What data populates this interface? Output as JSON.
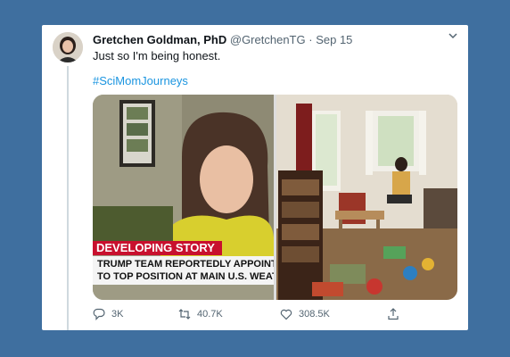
{
  "tweet": {
    "author_name": "Gretchen Goldman, PhD",
    "handle": "@GretchenTG",
    "separator": "·",
    "date": "Sep 15",
    "text": "Just so I'm being honest.",
    "hashtag": "#SciMomJourneys"
  },
  "media": {
    "left_photo": {
      "chyron_label": "DEVELOPING STORY",
      "chyron_line1": "TRUMP TEAM REPORTEDLY APPOINTS C",
      "chyron_line2": "TO TOP POSITION AT MAIN U.S. WEATH"
    }
  },
  "actions": {
    "reply_count": "3K",
    "retweet_count": "40.7K",
    "like_count": "308.5K"
  },
  "colors": {
    "background": "#3f6f9f",
    "link": "#1b95e0",
    "cnn_red": "#c8102e"
  },
  "icons": [
    "chevron-down-icon",
    "reply-icon",
    "retweet-icon",
    "like-icon",
    "share-icon"
  ]
}
